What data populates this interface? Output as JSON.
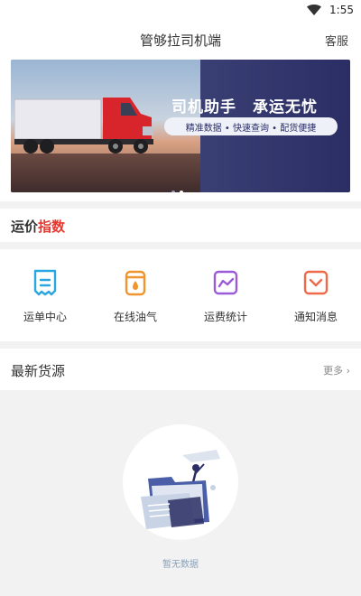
{
  "status_bar": {
    "time": "1:55"
  },
  "header": {
    "title": "管够拉司机端",
    "action": "客服"
  },
  "banner": {
    "headline": "司机助手　承运无忧",
    "subline": "精准数据 • 快速查询 • 配货便捷",
    "dots": 2,
    "active_dot": 1
  },
  "freight_index": {
    "title_part1": "运价",
    "title_part2": "指数",
    "highlight_color": "#e8352e"
  },
  "menu": [
    {
      "label": "运单中心",
      "icon": "waybill-icon",
      "color": "#2aa7e0"
    },
    {
      "label": "在线油气",
      "icon": "fuel-can-icon",
      "color": "#f0952d"
    },
    {
      "label": "运费统计",
      "icon": "chart-icon",
      "color": "#9b5bd8"
    },
    {
      "label": "通知消息",
      "icon": "envelope-icon",
      "color": "#ef6a4a"
    }
  ],
  "latest_cargo": {
    "title": "最新货源",
    "more": "更多 ›"
  },
  "empty_state": {
    "text": "暂无数据",
    "icon": "empty-folder-illustration"
  }
}
